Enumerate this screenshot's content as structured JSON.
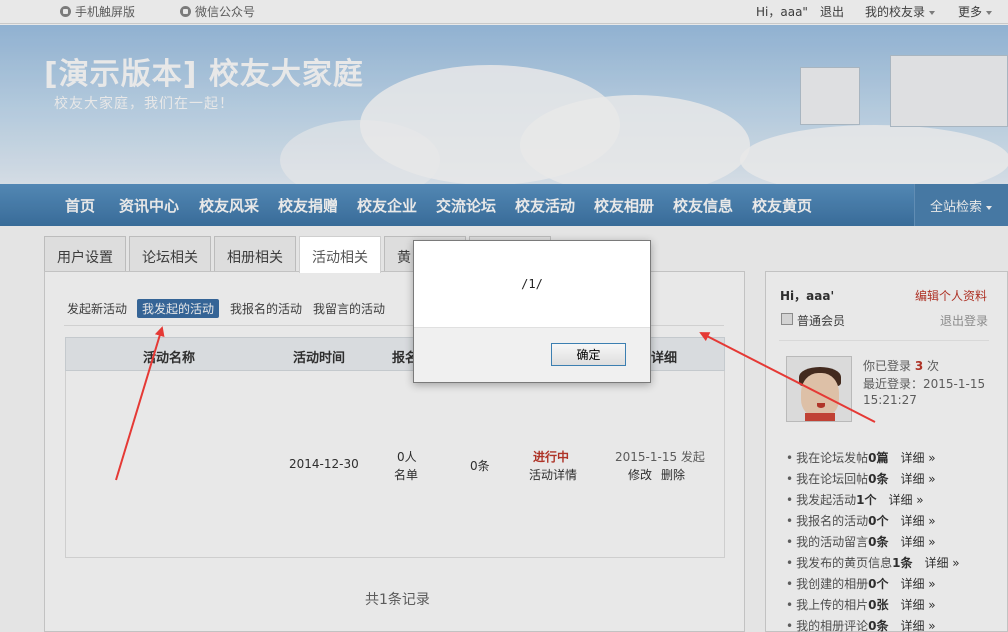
{
  "topbar": {
    "mobile": "手机触屏版",
    "wechat": "微信公众号",
    "greeting": "Hi，aaa\"",
    "logout": "退出",
    "my_school": "我的校友录",
    "more": "更多"
  },
  "banner": {
    "title": "[演示版本] 校友大家庭",
    "subtitle": "校友大家庭，我们在一起！"
  },
  "nav": {
    "items": [
      "首页",
      "资讯中心",
      "校友风采",
      "校友捐赠",
      "校友企业",
      "交流论坛",
      "校友活动",
      "校友相册",
      "校友信息",
      "校友黄页"
    ],
    "search": "全站检索"
  },
  "tabs": [
    "用户设置",
    "论坛相关",
    "相册相关",
    "活动相关",
    "黄"
  ],
  "subnav": [
    "发起新活动",
    "我发起的活动",
    "我报名的活动",
    "我留言的活动"
  ],
  "table": {
    "headers": [
      "活动名称",
      "活动时间",
      "报名",
      "详细"
    ],
    "row": {
      "time": "2014-12-30",
      "signup_count": "0人",
      "signup_list": "名单",
      "comments": "0条",
      "status": "进行中",
      "detail_link": "活动详情",
      "launched": "2015-1-15 发起",
      "edit": "修改",
      "delete": "删除"
    },
    "total": "共1条记录"
  },
  "sidebar": {
    "greeting": "Hi，aaa'",
    "edit_profile": "编辑个人资料",
    "member_level": "普通会员",
    "logout": "退出登录",
    "login_count_prefix": "你已登录",
    "login_count": "3",
    "login_count_suffix": "次",
    "last_login_label": "最近登录：2015-1-15",
    "last_login_time": "15:21:27",
    "stats": [
      {
        "pre": "我在论坛发帖",
        "num": "0篇"
      },
      {
        "pre": "我在论坛回帖",
        "num": "0条"
      },
      {
        "pre": "我发起活动",
        "num": "1个"
      },
      {
        "pre": "我报名的活动",
        "num": "0个"
      },
      {
        "pre": "我的活动留言",
        "num": "0条"
      },
      {
        "pre": "我发布的黄页信息",
        "num": "1条"
      },
      {
        "pre": "我创建的相册",
        "num": "0个"
      },
      {
        "pre": "我上传的相片",
        "num": "0张"
      },
      {
        "pre": "我的相册评论",
        "num": "0条"
      }
    ],
    "more_label": "详细 »"
  },
  "dialog": {
    "message": "/1/",
    "ok": "确定"
  },
  "colors": {
    "nav": "#4a86b8",
    "subnav_active": "#3b6ea5",
    "status": "#c0392b",
    "arrow": "#e53935"
  }
}
